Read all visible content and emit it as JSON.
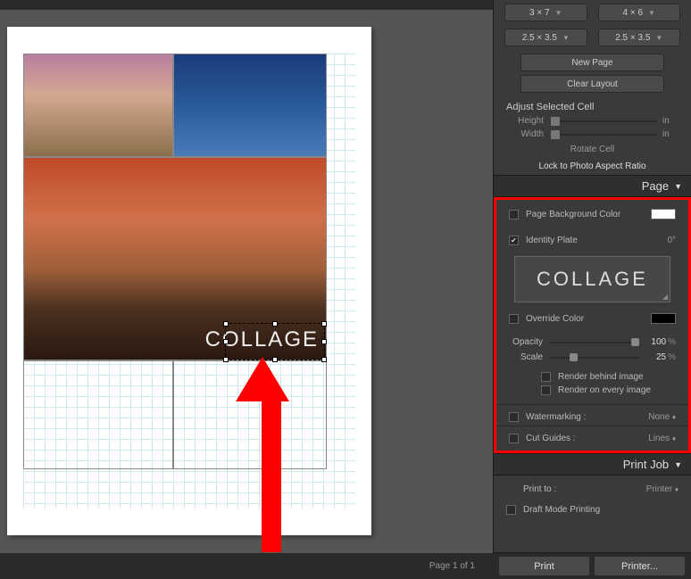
{
  "presets": {
    "row1": [
      "3 × 7",
      "4 × 6"
    ],
    "row2": [
      "2.5 × 3.5",
      "2.5 × 3.5"
    ]
  },
  "buttons": {
    "new_page": "New Page",
    "clear_layout": "Clear Layout",
    "rotate_cell": "Rotate Cell",
    "lock_aspect": "Lock to Photo Aspect Ratio",
    "print": "Print",
    "printer": "Printer..."
  },
  "adjust": {
    "title": "Adjust Selected Cell",
    "height": "Height",
    "width": "Width",
    "unit": "in"
  },
  "panels": {
    "page": "Page",
    "print_job": "Print Job"
  },
  "page_panel": {
    "bg_color": "Page Background Color",
    "identity_plate": "Identity Plate",
    "identity_angle": "0°",
    "plate_text": "COLLAGE",
    "override_color": "Override Color",
    "opacity_label": "Opacity",
    "opacity_value": "100",
    "scale_label": "Scale",
    "scale_value": "25",
    "pct": "%",
    "render_behind": "Render behind image",
    "render_every": "Render on every image",
    "watermarking": "Watermarking :",
    "watermarking_val": "None",
    "cut_guides": "Cut Guides :",
    "cut_guides_val": "Lines"
  },
  "print_job": {
    "print_to": "Print to :",
    "print_to_val": "Printer",
    "draft": "Draft Mode Printing"
  },
  "status": {
    "page_of": "Page 1 of 1"
  },
  "canvas": {
    "collage_label": "COLLAGE"
  },
  "swatches": {
    "bg": "#ffffff",
    "override": "#000000"
  }
}
